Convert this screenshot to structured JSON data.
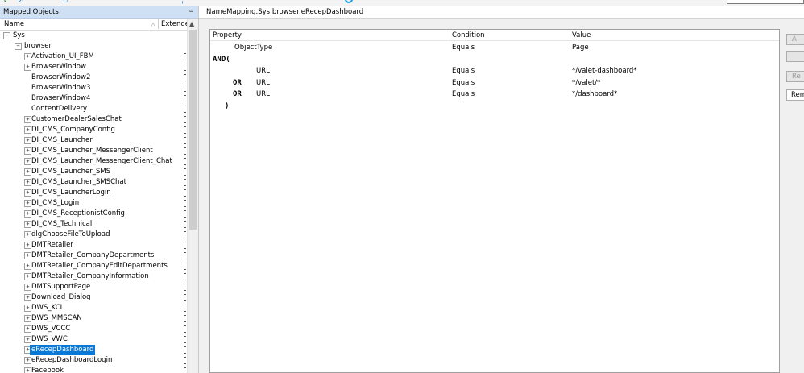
{
  "left_panel": {
    "title": "Mapped Objects",
    "col_name": "Name",
    "col_extended": "Extende",
    "tree": [
      {
        "label": "Sys",
        "depth": 0,
        "expander": "−"
      },
      {
        "label": "browser",
        "depth": 1,
        "expander": "−"
      },
      {
        "label": "Activation_UI_FBM",
        "depth": 2,
        "expander": "+"
      },
      {
        "label": "BrowserWindow",
        "depth": 2,
        "expander": "+"
      },
      {
        "label": "BrowserWindow2",
        "depth": 2,
        "expander": ""
      },
      {
        "label": "BrowserWindow3",
        "depth": 2,
        "expander": ""
      },
      {
        "label": "BrowserWindow4",
        "depth": 2,
        "expander": ""
      },
      {
        "label": "ContentDelivery",
        "depth": 2,
        "expander": ""
      },
      {
        "label": "CustomerDealerSalesChat",
        "depth": 2,
        "expander": "+"
      },
      {
        "label": "DI_CMS_CompanyConfig",
        "depth": 2,
        "expander": "+"
      },
      {
        "label": "DI_CMS_Launcher",
        "depth": 2,
        "expander": "+"
      },
      {
        "label": "DI_CMS_Launcher_MessengerClient",
        "depth": 2,
        "expander": "+"
      },
      {
        "label": "DI_CMS_Launcher_MessengerClient_Chat",
        "depth": 2,
        "expander": "+"
      },
      {
        "label": "DI_CMS_Launcher_SMS",
        "depth": 2,
        "expander": "+"
      },
      {
        "label": "DI_CMS_Launcher_SMSChat",
        "depth": 2,
        "expander": "+"
      },
      {
        "label": "DI_CMS_LauncherLogin",
        "depth": 2,
        "expander": "+"
      },
      {
        "label": "DI_CMS_Login",
        "depth": 2,
        "expander": "+"
      },
      {
        "label": "DI_CMS_ReceptionistConfig",
        "depth": 2,
        "expander": "+"
      },
      {
        "label": "DI_CMS_Technical",
        "depth": 2,
        "expander": "+"
      },
      {
        "label": "dlgChooseFileToUpload",
        "depth": 2,
        "expander": "+"
      },
      {
        "label": "DMTRetailer",
        "depth": 2,
        "expander": "+"
      },
      {
        "label": "DMTRetailer_CompanyDepartments",
        "depth": 2,
        "expander": "+"
      },
      {
        "label": "DMTRetailer_CompanyEditDepartments",
        "depth": 2,
        "expander": "+"
      },
      {
        "label": "DMTRetailer_CompanyInformation",
        "depth": 2,
        "expander": "+"
      },
      {
        "label": "DMTSupportPage",
        "depth": 2,
        "expander": "+"
      },
      {
        "label": "Download_Dialog",
        "depth": 2,
        "expander": "+"
      },
      {
        "label": "DWS_KCL",
        "depth": 2,
        "expander": "+"
      },
      {
        "label": "DWS_MMSCAN",
        "depth": 2,
        "expander": "+"
      },
      {
        "label": "DWS_VCCC",
        "depth": 2,
        "expander": "+"
      },
      {
        "label": "DWS_VWC",
        "depth": 2,
        "expander": "+"
      },
      {
        "label": "eRecepDashboard",
        "depth": 2,
        "expander": "+",
        "selected": true
      },
      {
        "label": "eRecepDashboardLogin",
        "depth": 2,
        "expander": "+"
      },
      {
        "label": "Facebook",
        "depth": 2,
        "expander": "+"
      }
    ]
  },
  "right_panel": {
    "header": "NameMapping.Sys.browser.eRecepDashboard",
    "columns": {
      "property": "Property",
      "condition": "Condition",
      "value": "Value"
    },
    "rows": [
      {
        "op": "",
        "property": "ObjectType",
        "indent": 27,
        "condition": "Equals",
        "value": "Page"
      },
      {
        "op": "AND(",
        "property": "",
        "indent": 0,
        "condition": "",
        "value": ""
      },
      {
        "op": "",
        "property": "URL",
        "indent": 54,
        "condition": "Equals",
        "value": "*/valet-dashboard*"
      },
      {
        "op": "OR",
        "property": "URL",
        "indent": 54,
        "condition": "Equals",
        "value": "*/valet/*"
      },
      {
        "op": "OR",
        "property": "URL",
        "indent": 54,
        "condition": "Equals",
        "value": "*/dashboard*"
      },
      {
        "op": ")",
        "property": "",
        "indent": 0,
        "condition": "",
        "value": ""
      }
    ],
    "buttons": [
      "A",
      "",
      "Re",
      "Rem"
    ]
  },
  "colors": {
    "selection": "#0a78d7",
    "panel_title": "#cfe0f4"
  }
}
